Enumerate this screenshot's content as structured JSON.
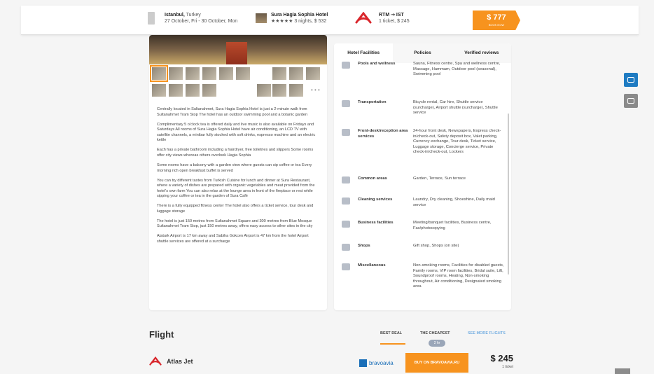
{
  "topbar": {
    "destination": {
      "city": "Istanbul,",
      "country": " Turkey",
      "dates": "27 October, Fri - 30 October, Mon"
    },
    "hotel": {
      "name": "Sura Hagia Sophia Hotel",
      "detail": "★★★★★ 3 nights, $ 532"
    },
    "flight": {
      "route": "RTM ⇢ IST",
      "detail": "1 ticket, $ 245"
    },
    "price": {
      "amount": "$ 777",
      "cta": "BOOK NOW"
    }
  },
  "description": [
    "Centrally located in Sultanahmet, Sura Hagia Sophia Hotel is just a 2-minute walk from Sultanahmet Tram Stop The hotel has an outdoor swimming pool and a botanic garden",
    "Complimentary 5 o'clock tea is offered daily and live music is also available on Fridays and Saturdays All rooms of Sura Hagia Sophia Hotel have air conditioning, an LCD TV with satellite channels, a minibar fully stocked with soft drinks, espresso machine and an electric kettle",
    "Each has a private bathroom including a hairdryer, free toiletries and slippers Some rooms offer city views whereas others overlook Hagia Sophia",
    "Some rooms have a balcony with a garden view where guests can sip coffee or tea Every morning rich open breakfast buffet is served",
    "You can try different tastes from Turkish Cuisine for lunch and dinner at Sura Restaurant, where a variety of dishes are prepared with organic vegetables and meat provided from the hotel's own farm You can also relax at the lounge area in front of the fireplace or rest while sipping your coffee or tea in the garden of Sura Café",
    "There is a fully equipped fitness center The hotel also offers a ticket service, tour desk and luggage storage",
    "The hotel is just 150 metres from Sultanahmet Square and 300 metres from Blue Mosque Sultanahmet Tram Stop, just 150 metres away, offers easy access to other sites in the city",
    "Ataturk Airport is 17 km away and Sabiha Gokcen Airport is 47 km from the hotel Airport shuttle services are offered at a surcharge"
  ],
  "thumbs_more": "• • •",
  "tabs": [
    "Hotel Facilities",
    "Policies",
    "Verified reviews"
  ],
  "facilities": [
    {
      "icon": "pool-icon",
      "name": "Pools and wellness",
      "value": "Sauna, Fitness centre, Spa and wellness centre, Massage, Hammam, Outdoor pool (seasonal), Swimming pool"
    },
    {
      "icon": "bus-icon",
      "name": "Transportation",
      "value": "Bicycle rental, Car hire, Shuttle service (surcharge), Airport shuttle (surcharge), Shuttle service"
    },
    {
      "icon": "bellhop-icon",
      "name": "Front-desk/reception area services",
      "value": "24-hour front desk, Newspapers, Express check-in/check-out, Safety deposit box, Valet parking, Currency exchange, Tour desk, Ticket service, Luggage storage, Concierge service, Private check-in/check-out, Lockers"
    },
    {
      "icon": "sofa-icon",
      "name": "Common areas",
      "value": "Garden, Terrace, Sun terrace"
    },
    {
      "icon": "spray-icon",
      "name": "Cleaning services",
      "value": "Laundry, Dry cleaning, Shoeshine, Daily maid service"
    },
    {
      "icon": "briefcase-icon",
      "name": "Business facilities",
      "value": "Meeting/banquet facilities, Business centre, Fax/photocopying"
    },
    {
      "icon": "shop-icon",
      "name": "Shops",
      "value": "Gift shop, Shops (on site)"
    },
    {
      "icon": "misc-icon",
      "name": "Miscellaneous",
      "value": "Non-smoking rooms, Facilities for disabled guests, Family rooms, VIP room facilities, Bridal suite, Lift, Soundproof rooms, Heating, Non-smoking throughout, Air conditioning, Designated smoking area"
    }
  ],
  "flight": {
    "title": "Flight",
    "sort": [
      "BEST DEAL",
      "THE CHEAPEST"
    ],
    "pill": "2 hr",
    "see_more": "SEE MORE FLIGHTS",
    "airline": "Atlas Jet",
    "provider": "bravoavia",
    "buy": "BUY ON BRAVOAVIA.RU",
    "price": "$ 245",
    "price_sub": "1 ticket"
  },
  "colors": {
    "accent": "#f7931e",
    "link": "#3b8ed8",
    "airline_red": "#d9262c"
  }
}
